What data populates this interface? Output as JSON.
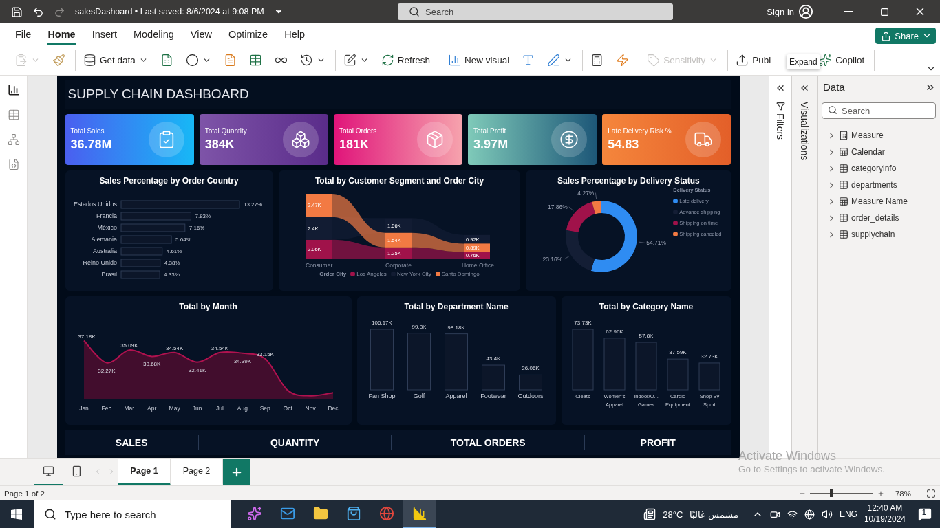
{
  "title_bar": {
    "document": "salesDashoard • Last saved: 8/6/2024 at 9:08 PM",
    "search_placeholder": "Search",
    "sign_in": "Sign in"
  },
  "menu": {
    "tabs": [
      {
        "label": "File",
        "selected": false
      },
      {
        "label": "Home",
        "selected": true
      },
      {
        "label": "Insert",
        "selected": false
      },
      {
        "label": "Modeling",
        "selected": false
      },
      {
        "label": "View",
        "selected": false
      },
      {
        "label": "Optimize",
        "selected": false
      },
      {
        "label": "Help",
        "selected": false
      }
    ],
    "share": "Share"
  },
  "ribbon": {
    "groups": [
      {
        "items": [
          {
            "dropdown": true,
            "disabled": true
          },
          {
            "dropdown": false,
            "disabled": false
          }
        ]
      },
      {
        "items": [
          {
            "label": "Get data",
            "dropdown": true,
            "disabled": false
          },
          {
            "dropdown": false,
            "disabled": false
          },
          {
            "dropdown": true,
            "disabled": false
          },
          {
            "dropdown": false,
            "disabled": false
          },
          {
            "dropdown": false,
            "disabled": false
          },
          {
            "dropdown": false,
            "disabled": false
          },
          {
            "dropdown": true,
            "disabled": false
          }
        ]
      },
      {
        "items": [
          {
            "dropdown": true,
            "disabled": false
          },
          {
            "label": "Refresh",
            "dropdown": false,
            "disabled": false
          }
        ]
      },
      {
        "items": [
          {
            "label": "New visual",
            "dropdown": false,
            "disabled": false
          },
          {
            "dropdown": false,
            "disabled": false
          },
          {
            "dropdown": true,
            "disabled": false
          }
        ]
      },
      {
        "items": [
          {
            "dropdown": false,
            "disabled": false
          },
          {
            "dropdown": false,
            "disabled": false
          }
        ]
      },
      {
        "items": [
          {
            "label": "Sensitivity",
            "dropdown": true,
            "disabled": true
          }
        ]
      },
      {
        "items": [
          {
            "label": "Publ",
            "dropdown": false,
            "disabled": false
          },
          {
            "label": "Copilot",
            "dropdown": false,
            "disabled": false
          }
        ]
      }
    ],
    "tooltip": "Expand"
  },
  "left_nav": [
    {
      "selected": true
    },
    {
      "selected": false
    },
    {
      "selected": false
    },
    {
      "selected": false
    }
  ],
  "dashboard": {
    "title": "SUPPLY CHAIN DASHBOARD",
    "kpis": [
      {
        "label": "Total Sales",
        "value": "36.78M",
        "color": "#4a5ff0"
      },
      {
        "label": "Total Quantity",
        "value": "384K",
        "color": "#7e54a8"
      },
      {
        "label": "Total Orders",
        "value": "181K",
        "color": "#e0147a"
      },
      {
        "label": "Total Profit",
        "value": "3.97M",
        "color": "#7fcab9"
      },
      {
        "label": "Late Delivery Risk %",
        "value": "54.83",
        "color": "#f5863c"
      }
    ],
    "country": {
      "title": "Sales Percentage by Order Country",
      "chart_data": {
        "type": "bar",
        "orientation": "horizontal",
        "categories": [
          "Estados Unidos",
          "Francia",
          "México",
          "Alemania",
          "Australia",
          "Reino Unido",
          "Brasil"
        ],
        "values": [
          13.27,
          7.83,
          7.16,
          5.64,
          4.61,
          4.38,
          4.33
        ],
        "value_labels": [
          "13.27%",
          "7.83%",
          "7.16%",
          "5.64%",
          "4.61%",
          "4.38%",
          "4.33%"
        ]
      }
    },
    "segment": {
      "title": "Total by Customer Segment and Order City",
      "legend_title": "Order City",
      "chart_data": {
        "type": "bar",
        "stacked": true,
        "categories": [
          "Consumer",
          "Corporate",
          "Home Office"
        ],
        "series": [
          {
            "name": "Los Angeles",
            "color": "#a0124a",
            "values": [
              2.06,
              1.25,
              0.76
            ],
            "value_labels": [
              "2.06K",
              "1.25K",
              "0.76K"
            ]
          },
          {
            "name": "New York City",
            "color": "#121c33",
            "values": [
              2.4,
              1.56,
              0.92
            ],
            "value_labels": [
              "2.4K",
              "1.56K",
              "0.92K"
            ]
          },
          {
            "name": "Santo Domingo",
            "color": "#f27a43",
            "values": [
              2.47,
              1.54,
              0.89
            ],
            "value_labels": [
              "2.47K",
              "1.54K",
              "0.89K"
            ]
          }
        ]
      }
    },
    "delivery": {
      "title": "Sales Percentage by Delivery Status",
      "legend_title": "Delivery Status",
      "chart_data": {
        "type": "donut",
        "categories": [
          "Late delivery",
          "Advance shipping",
          "Shipping on time",
          "Shipping canceled"
        ],
        "colors": [
          "#2f8cf2",
          "#141e35",
          "#a0124a",
          "#f27a43"
        ],
        "values": [
          54.71,
          23.16,
          17.86,
          4.27
        ],
        "value_labels": [
          "54.71%",
          "23.16%",
          "17.86%",
          "4.27%"
        ]
      }
    },
    "month": {
      "title": "Total by Month",
      "chart_data": {
        "type": "area",
        "categories": [
          "Jan",
          "Feb",
          "Mar",
          "Apr",
          "May",
          "Jun",
          "Jul",
          "Aug",
          "Sep",
          "Oct",
          "Nov",
          "Dec"
        ],
        "values": [
          37.18,
          32.27,
          35.09,
          33.68,
          34.54,
          32.41,
          34.54,
          34.39,
          33.15,
          26.1,
          24.9,
          25.6
        ],
        "value_labels": [
          "37.18K",
          "32.27K",
          "35.09K",
          "33.68K",
          "34.54K",
          "32.41K",
          "34.54K",
          "34.39K",
          "33.15K",
          null,
          null,
          null
        ]
      }
    },
    "department": {
      "title": "Total by Department Name",
      "chart_data": {
        "type": "bar",
        "categories": [
          "Fan Shop",
          "Golf",
          "Apparel",
          "Footwear",
          "Outdoors"
        ],
        "values": [
          106.17,
          99.3,
          98.18,
          43.4,
          26.06
        ],
        "value_labels": [
          "106.17K",
          "99.3K",
          "98.18K",
          "43.4K",
          "26.06K"
        ]
      }
    },
    "category": {
      "title": "Total by Category Name",
      "chart_data": {
        "type": "bar",
        "categories": [
          "Cleats",
          "Women's Apparel",
          "Indoor/O... Games",
          "Cardio Equipment",
          "Shop By Sport"
        ],
        "values": [
          73.73,
          62.96,
          57.8,
          37.59,
          32.73
        ],
        "value_labels": [
          "73.73K",
          "62.96K",
          "57.8K",
          "37.59K",
          "32.73K"
        ]
      }
    },
    "nav_buttons": [
      "SALES",
      "QUANTITY",
      "TOTAL ORDERS",
      "PROFIT"
    ]
  },
  "panes": {
    "filters": "Filters",
    "visualizations": "Visualizations",
    "data": {
      "title": "Data",
      "search_placeholder": "Search",
      "tables": [
        {
          "name": "Measure",
          "kind": "measure"
        },
        {
          "name": "Calendar",
          "kind": "calculated"
        },
        {
          "name": "categoryinfo",
          "kind": "table"
        },
        {
          "name": "departments",
          "kind": "table"
        },
        {
          "name": "Measure Name",
          "kind": "calculated"
        },
        {
          "name": "order_details",
          "kind": "table"
        },
        {
          "name": "supplychain",
          "kind": "table"
        }
      ]
    }
  },
  "pages": [
    {
      "label": "Page 1",
      "selected": true
    },
    {
      "label": "Page 2",
      "selected": false
    }
  ],
  "activation": {
    "title": "Activate Windows",
    "subtitle": "Go to Settings to activate Windows."
  },
  "status_bar": {
    "page": "Page 1 of 2",
    "zoom": {
      "level": 0.32,
      "reading": "78%"
    }
  },
  "taskbar": {
    "search_placeholder": "Type here to search",
    "apps": [
      {
        "selected": false
      },
      {
        "selected": false
      },
      {
        "selected": false
      },
      {
        "selected": false
      },
      {
        "selected": false
      },
      {
        "selected": true
      }
    ],
    "temperature": "28°C",
    "weather": "مشمس غالبًا",
    "language": "ENG",
    "time": "12:40 AM",
    "date": "10/19/2024",
    "notifications": "1"
  }
}
